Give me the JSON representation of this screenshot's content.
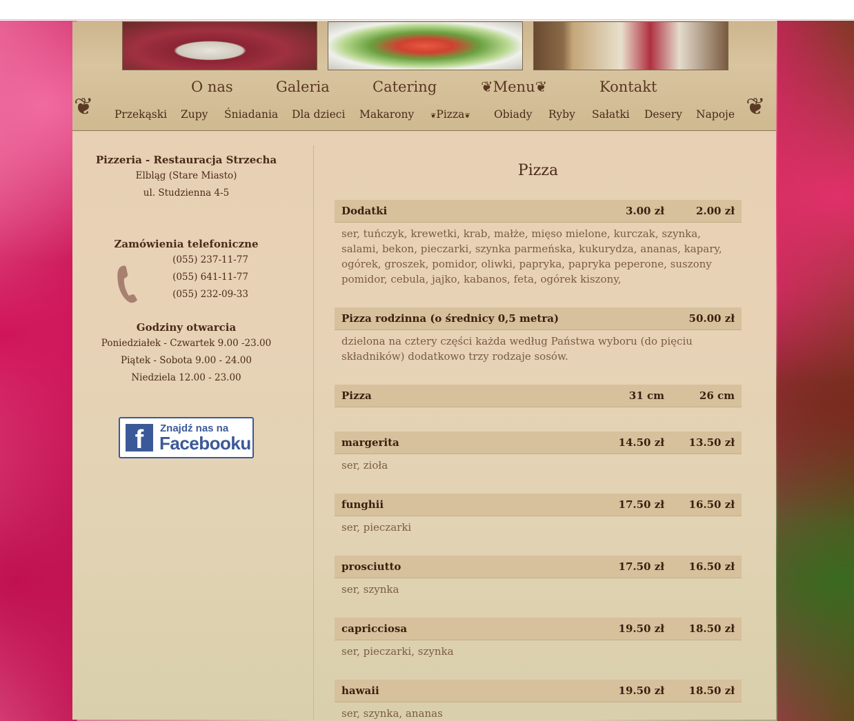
{
  "nav": {
    "main": [
      "O nas",
      "Galeria",
      "Catering",
      "Menu",
      "Kontakt"
    ],
    "sub": [
      "Przekąski",
      "Zupy",
      "Śniadania",
      "Dla dzieci",
      "Makarony",
      "Pizza",
      "Obiady",
      "Ryby",
      "Sałatki",
      "Desery",
      "Napoje"
    ]
  },
  "sidebar": {
    "name": "Pizzeria - Restauracja Strzecha",
    "city": "Elbląg (Stare Miasto)",
    "street": "ul. Studzienna 4-5",
    "phone_heading": "Zamówienia telefoniczne",
    "phones": [
      "(055) 237-11-77",
      "(055) 641-11-77",
      "(055) 232-09-33"
    ],
    "hours_heading": "Godziny otwarcia",
    "hours": [
      "Poniedziałek - Czwartek 9.00 -23.00",
      "Piątek - Sobota 9.00 - 24.00",
      "Niedziela 12.00 - 23.00"
    ],
    "facebook_line1": "Znajdź nas na",
    "facebook_line2": "Facebooku",
    "facebook_letter": "f"
  },
  "content": {
    "title": "Pizza",
    "items": [
      {
        "name": "Dodatki",
        "c1": "3.00 zł",
        "c2": "2.00 zł",
        "desc": "ser, tuńczyk, krewetki, krab, małże, mięso mielone, kurczak, szynka, salami, bekon, pieczarki, szynka parmeńska, kukurydza, ananas, kapary, ogórek, groszek, pomidor, oliwki, papryka, papryka peperone, suszony pomidor, cebula, jajko, kabanos, feta, ogórek kiszony,"
      },
      {
        "name": "Pizza rodzinna (o średnicy 0,5 metra)",
        "c1": "",
        "c2": "50.00 zł",
        "desc": "dzielona na cztery części każda według Państwa wyboru (do pięciu składników) dodatkowo trzy rodzaje sosów."
      },
      {
        "name": "Pizza",
        "c1": "31 cm",
        "c2": "26 cm",
        "desc": ""
      },
      {
        "name": "margerita",
        "c1": "14.50 zł",
        "c2": "13.50 zł",
        "desc": "ser, zioła"
      },
      {
        "name": "funghii",
        "c1": "17.50 zł",
        "c2": "16.50 zł",
        "desc": "ser, pieczarki"
      },
      {
        "name": "prosciutto",
        "c1": "17.50 zł",
        "c2": "16.50 zł",
        "desc": "ser, szynka"
      },
      {
        "name": "capricciosa",
        "c1": "19.50 zł",
        "c2": "18.50 zł",
        "desc": "ser, pieczarki, szynka"
      },
      {
        "name": "hawaii",
        "c1": "19.50 zł",
        "c2": "18.50 zł",
        "desc": "ser, szynka, ananas"
      }
    ]
  }
}
